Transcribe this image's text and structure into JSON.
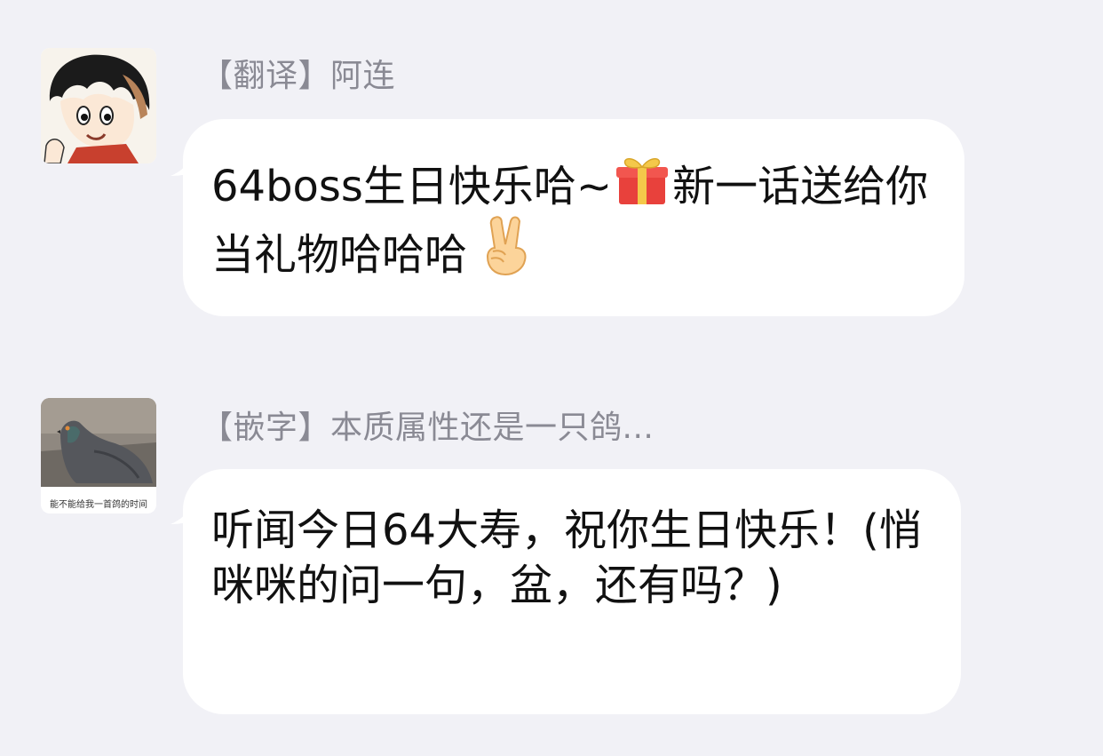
{
  "messages": [
    {
      "sender": "【翻译】阿连",
      "text_before_gift": "64boss生日快乐哈~",
      "gift_icon": "gift-emoji",
      "text_after_gift": "新一话送给你当礼物哈哈哈 ",
      "victory_icon": "victory-hand-emoji",
      "avatar": "anime-character-avatar"
    },
    {
      "sender": "【嵌字】本质属性还是一只鸽...",
      "text": "听闻今日64大寿，祝你生日快乐！(悄咪咪的问一句，盆，还有吗？)",
      "avatar": "pigeon-photo-avatar",
      "avatar_caption": "能不能给我一首鸽的时间"
    }
  ],
  "colors": {
    "background": "#f1f1f6",
    "bubble": "#ffffff",
    "sender_name": "#8a8a94",
    "message_text": "#111111"
  }
}
